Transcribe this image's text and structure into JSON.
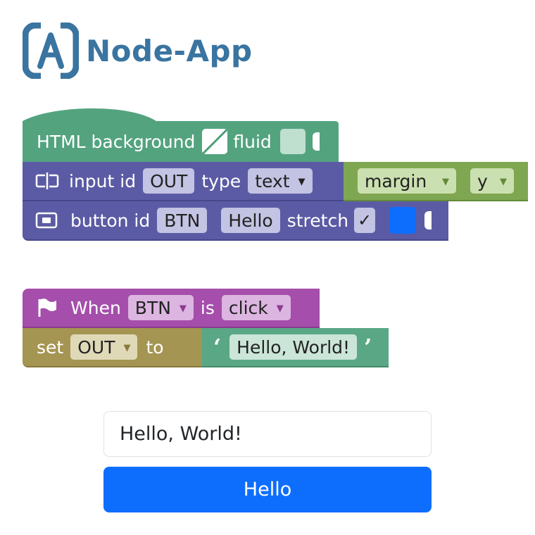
{
  "app": {
    "title": "Node-App"
  },
  "colors": {
    "brand": "#3a74a0",
    "html_block": "#53a37f",
    "dom_block": "#5b5ba5",
    "style_block": "#7fa651",
    "event_block": "#a54eab",
    "var_block": "#a59552",
    "text_block": "#5aa786",
    "primary_button": "#0d6efd"
  },
  "blocks": {
    "html": {
      "label": "HTML background",
      "fluid_label": "fluid"
    },
    "input": {
      "icon": "input-icon",
      "prefix": "input id",
      "id_value": "OUT",
      "type_label": "type",
      "type_value": "text",
      "style_prop": "margin",
      "style_axis": "y"
    },
    "button": {
      "icon": "button-icon",
      "prefix": "button id",
      "id_value": "BTN",
      "text_value": "Hello",
      "stretch_label": "stretch",
      "stretch_checked": "✓",
      "color": "#0d6efd"
    },
    "event": {
      "icon": "flag-icon",
      "when_label": "When",
      "target": "BTN",
      "is_label": "is",
      "event_name": "click"
    },
    "set": {
      "set_label": "set",
      "var_name": "OUT",
      "to_label": "to",
      "open_quote": "‘",
      "text_value": "Hello, World!",
      "close_quote": "’"
    }
  },
  "output": {
    "input_value": "Hello, World!",
    "button_label": "Hello"
  }
}
